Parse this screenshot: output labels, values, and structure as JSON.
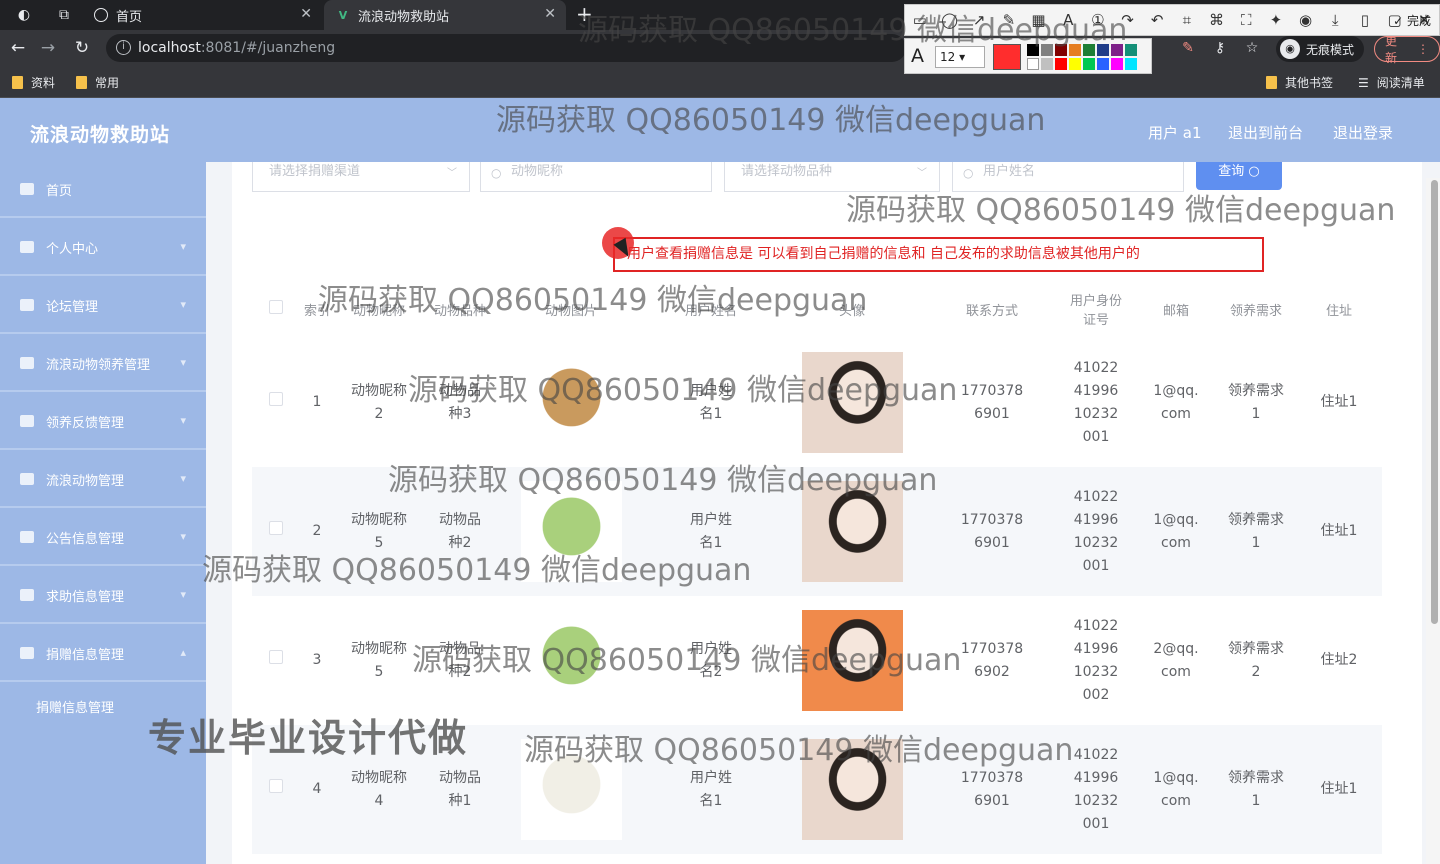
{
  "browser": {
    "tabs": [
      {
        "label": "首页",
        "active": false
      },
      {
        "label": "流浪动物救助站",
        "active": true
      }
    ],
    "url_host": "localhost",
    "url_rest": ":8081/#/juanzheng",
    "incognito_label": "无痕模式",
    "update_label": "更新",
    "bookmarks": [
      "资料",
      "常用"
    ],
    "bookmarks_right": [
      "其他书签",
      "阅读清单"
    ]
  },
  "annotation_toolbar": {
    "done_label": "完成",
    "font_size": "12",
    "current_color": "#ff2d2d"
  },
  "app": {
    "title": "流浪动物救助站",
    "header_links": [
      "用户 a1",
      "退出到前台",
      "退出登录"
    ]
  },
  "sidebar": {
    "items": [
      {
        "label": "首页",
        "icon": "home-icon"
      },
      {
        "label": "个人中心",
        "icon": "user-icon"
      },
      {
        "label": "论坛管理",
        "icon": "forum-icon"
      },
      {
        "label": "流浪动物领养管理",
        "icon": "flag-icon"
      },
      {
        "label": "领养反馈管理",
        "icon": "feedback-icon"
      },
      {
        "label": "流浪动物管理",
        "icon": "list-icon"
      },
      {
        "label": "公告信息管理",
        "icon": "notice-icon"
      },
      {
        "label": "求助信息管理",
        "icon": "help-icon"
      },
      {
        "label": "捐赠信息管理",
        "icon": "donate-icon"
      }
    ],
    "sub_item": "捐赠信息管理"
  },
  "filters": {
    "channel_placeholder": "请选择捐赠渠道",
    "nickname_placeholder": "动物昵称",
    "breed_placeholder": "请选择动物品种",
    "username_placeholder": "用户姓名",
    "query_label": "查询"
  },
  "note": "用户查看捐赠信息是 可以看到自己捐赠的信息和 自己发布的求助信息被其他用户的",
  "table": {
    "headers": [
      "索引",
      "动物昵称",
      "动物品种",
      "动物图片",
      "用户姓名",
      "头像",
      "联系方式",
      "用户身份证号",
      "邮箱",
      "领养需求",
      "住址"
    ],
    "rows": [
      {
        "index": "1",
        "nickname": "动物昵称2",
        "breed": "动物品种3",
        "username": "用户姓名1",
        "phone": "17703786901",
        "idcard": "410224199610232001",
        "email": "1@qq.com",
        "need": "领养需求1",
        "address": "住址1",
        "pet_color": "#c99a5e",
        "avatar_color": "#e9d7cc"
      },
      {
        "index": "2",
        "nickname": "动物昵称5",
        "breed": "动物品种2",
        "username": "用户姓名1",
        "phone": "17703786901",
        "idcard": "410224199610232001",
        "email": "1@qq.com",
        "need": "领养需求1",
        "address": "住址1",
        "pet_color": "#a9d07c",
        "avatar_color": "#e9d7cc"
      },
      {
        "index": "3",
        "nickname": "动物昵称5",
        "breed": "动物品种2",
        "username": "用户姓名2",
        "phone": "17703786902",
        "idcard": "410224199610232002",
        "email": "2@qq.com",
        "need": "领养需求2",
        "address": "住址2",
        "pet_color": "#a9d07c",
        "avatar_color": "#f08a4b"
      },
      {
        "index": "4",
        "nickname": "动物昵称4",
        "breed": "动物品种1",
        "username": "用户姓名1",
        "phone": "17703786901",
        "idcard": "410224199610232001",
        "email": "1@qq.com",
        "need": "领养需求1",
        "address": "住址1",
        "pet_color": "#f1efe6",
        "avatar_color": "#e9d7cc"
      }
    ]
  },
  "watermark_text": "源码获取 QQ86050149 微信deepguan",
  "promo_text": "专业毕业设计代做"
}
